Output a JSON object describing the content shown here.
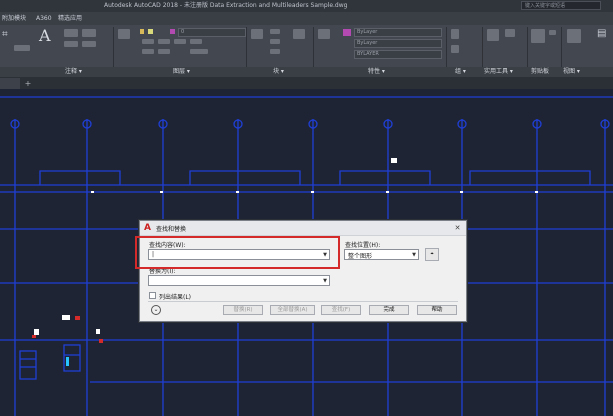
{
  "window": {
    "title": "Autodesk AutoCAD 2018 - 未注册版    Data Extraction and Multileaders Sample.dwg",
    "search_placeholder": "键入关键字或短语"
  },
  "ribbon": {
    "tabs": [
      "附加模块",
      "A360",
      "精选应用"
    ],
    "panels": [
      "注释 ▾",
      "图层 ▾",
      "块 ▾",
      "特性 ▾",
      "组 ▾",
      "实用工具 ▾",
      "剪贴板",
      "视图 ▾"
    ],
    "combos": {
      "color": "ByLayer",
      "linetype": "ByLayer",
      "lineweight": "BYLAYER",
      "layer_num": "0"
    }
  },
  "dialog": {
    "title": "查找和替换",
    "close_glyph": "✕",
    "find_label": "查找内容(W):",
    "find_value": "|",
    "replace_label": "替换为(I):",
    "replace_value": "",
    "location_label": "查找位置(H):",
    "location_value": "整个图形",
    "list_results_label": "列出结果(L)",
    "buttons": {
      "replace": "替换(R)",
      "replace_all": "全部替换(A)",
      "find": "查找(F)",
      "done": "完成",
      "help": "帮助"
    }
  },
  "colors": {
    "accent": "#d42a2a",
    "lines": "#1f3fd6",
    "canvas": "#1e2433"
  }
}
